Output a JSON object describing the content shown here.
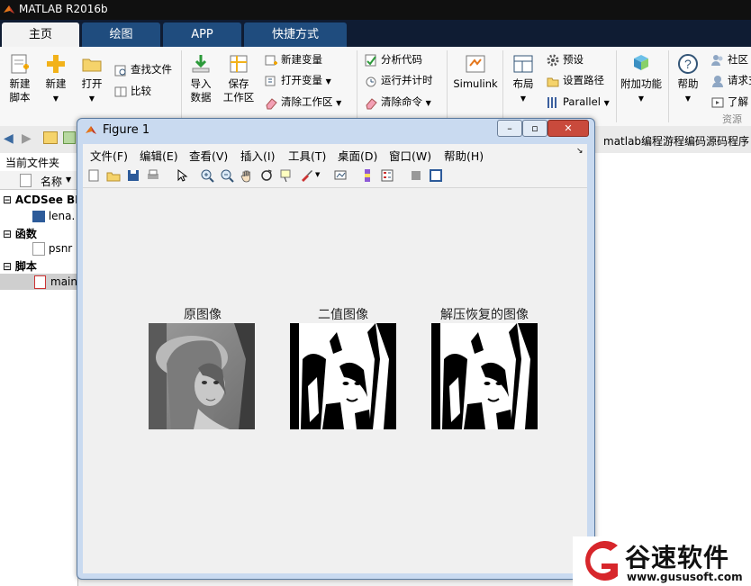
{
  "app": {
    "title": "MATLAB R2016b"
  },
  "tabs": [
    {
      "label": "主页"
    },
    {
      "label": "绘图"
    },
    {
      "label": "APP"
    },
    {
      "label": "快捷方式"
    }
  ],
  "ribbon": {
    "new_script": "新建\n脚本",
    "new": "新建",
    "open": "打开",
    "find_files": "查找文件",
    "compare": "比较",
    "import_data": "导入\n数据",
    "save_workspace": "保存\n工作区",
    "new_variable": "新建变量",
    "open_variable": "打开变量",
    "clear_workspace": "清除工作区",
    "analyze_code": "分析代码",
    "run_and_time": "运行并计时",
    "clear_commands": "清除命令",
    "simulink": "Simulink",
    "layout": "布局",
    "preferences": "预设",
    "set_path": "设置路径",
    "parallel": "Parallel",
    "add_ons": "附加功能",
    "help": "帮助",
    "community": "社区",
    "request": "请求支",
    "learn": "了解",
    "resources": "资源"
  },
  "address": {
    "path": "matlab编程游程编码源码程序"
  },
  "current_folder": {
    "label": "当前文件夹",
    "name_header": "名称",
    "groups": [
      {
        "title": "ACDSee BM",
        "file": "lena."
      },
      {
        "title": "函数",
        "file": "psnr"
      },
      {
        "title": "脚本",
        "file": "main"
      }
    ]
  },
  "figure": {
    "title": "Figure 1",
    "menu": [
      "文件(F)",
      "编辑(E)",
      "查看(V)",
      "插入(I)",
      "工具(T)",
      "桌面(D)",
      "窗口(W)",
      "帮助(H)"
    ],
    "subplots": [
      {
        "title": "原图像"
      },
      {
        "title": "二值图像"
      },
      {
        "title": "解压恢复的图像"
      }
    ]
  },
  "watermark": {
    "name": "谷速软件",
    "url": "www.gususoft.com"
  },
  "colors": {
    "tab_active": "#f2f2f2",
    "tab_inactive": "#1f4c7e",
    "titlebar": "#101010",
    "figure_frame": "#c9daf0"
  }
}
